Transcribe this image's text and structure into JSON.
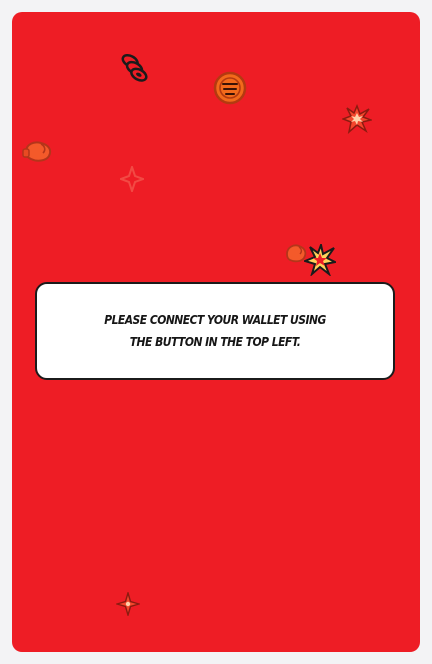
{
  "card": {
    "background_color": "#ee1d25"
  },
  "message": {
    "text": "Please connect your wallet using the button in the top left."
  },
  "decorations": [
    {
      "icon": "stacked-coins-icon"
    },
    {
      "icon": "spiral-coin-icon"
    },
    {
      "icon": "explosion-burst-icon"
    },
    {
      "icon": "boxing-glove-icon"
    },
    {
      "icon": "faded-sparkle-icon"
    },
    {
      "icon": "boxing-glove-small-icon"
    },
    {
      "icon": "explosion-burst-small-icon"
    },
    {
      "icon": "sparkle-star-icon"
    }
  ]
}
